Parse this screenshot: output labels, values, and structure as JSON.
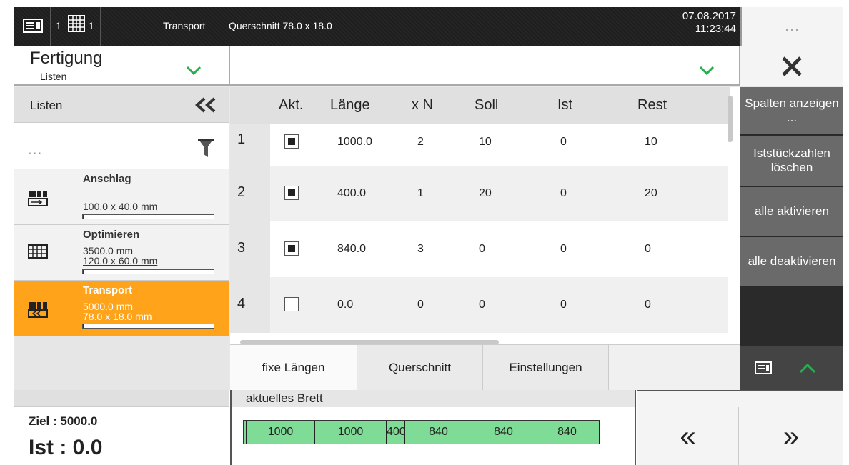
{
  "header": {
    "counter_left": "1",
    "counter_right": "1",
    "mode": "Transport",
    "section": "Querschnitt 78.0 x 18.0",
    "date": "07.08.2017",
    "time": "11:23:44",
    "menu_label": "..."
  },
  "nav": {
    "title": "Fertigung",
    "subtitle": "Listen"
  },
  "left_panel": {
    "heading": "Listen",
    "more": "...",
    "items": [
      {
        "title": "Anschlag",
        "line1": "100.0 x 40.0 mm",
        "line2": "",
        "icon": "stop-icon",
        "progress": 0.0
      },
      {
        "title": "Optimieren",
        "line1": "3500.0 mm",
        "line2": "120.0 x 60.0 mm",
        "icon": "grid-icon",
        "progress": 0.0
      },
      {
        "title": "Transport",
        "line1": "5000.0 mm",
        "line2": "78.0 x 18.0 mm",
        "icon": "transport-icon",
        "progress": 0.0,
        "active": true
      }
    ]
  },
  "table": {
    "columns": [
      "Akt.",
      "Länge",
      "x N",
      "Soll",
      "Ist",
      "Rest"
    ],
    "rows": [
      {
        "num": "1",
        "active": true,
        "laenge": "1000.0",
        "xn": "2",
        "soll": "10",
        "ist": "0",
        "rest": "10"
      },
      {
        "num": "2",
        "active": true,
        "laenge": "400.0",
        "xn": "1",
        "soll": "20",
        "ist": "0",
        "rest": "20"
      },
      {
        "num": "3",
        "active": true,
        "laenge": "840.0",
        "xn": "3",
        "soll": "0",
        "ist": "0",
        "rest": "0"
      },
      {
        "num": "4",
        "active": false,
        "laenge": "0.0",
        "xn": "0",
        "soll": "0",
        "ist": "0",
        "rest": "0"
      }
    ]
  },
  "tabs": [
    "fixe Längen",
    "Querschnitt",
    "Einstellungen"
  ],
  "right_panel": {
    "buttons": [
      "Spalten anzeigen ...",
      "Iststückzahlen löschen",
      "alle aktivieren",
      "alle deaktivieren"
    ]
  },
  "bottom": {
    "ziel": "Ziel : 5000.0",
    "ist": "Ist : 0.0",
    "brett_label": "aktuelles Brett",
    "segments": [
      "1000",
      "1000",
      "400",
      "840",
      "840",
      "840"
    ],
    "prev": "«",
    "next": "»"
  },
  "colors": {
    "accent": "#ffa31a",
    "green": "#22b14c",
    "segment_fill": "#7fdc96"
  }
}
